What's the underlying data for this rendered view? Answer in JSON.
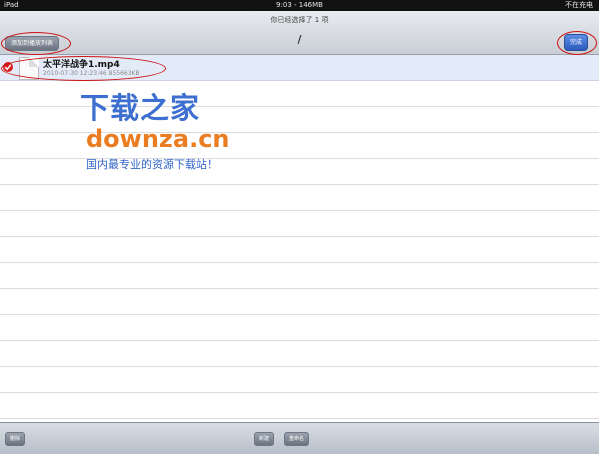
{
  "status_bar": {
    "device": "iPad",
    "time_battery": "9:03 - 146MB",
    "charging": "不在充电"
  },
  "nav": {
    "title": "你已经选择了 1 项",
    "path": "/",
    "cancel_label": "添加到播放列表",
    "done_label": "完成"
  },
  "files": [
    {
      "name": "太平洋战争1.mp4",
      "meta": "2010-07-30 12:23:46  855663KB",
      "selected": true
    }
  ],
  "watermark": {
    "brand_cn": "下载之家",
    "brand_en": "downza.cn",
    "slogan": "国内最专业的资源下载站！"
  },
  "toolbar": {
    "delete_label": "删除",
    "new_label": "新建",
    "rename_label": "重命名"
  }
}
